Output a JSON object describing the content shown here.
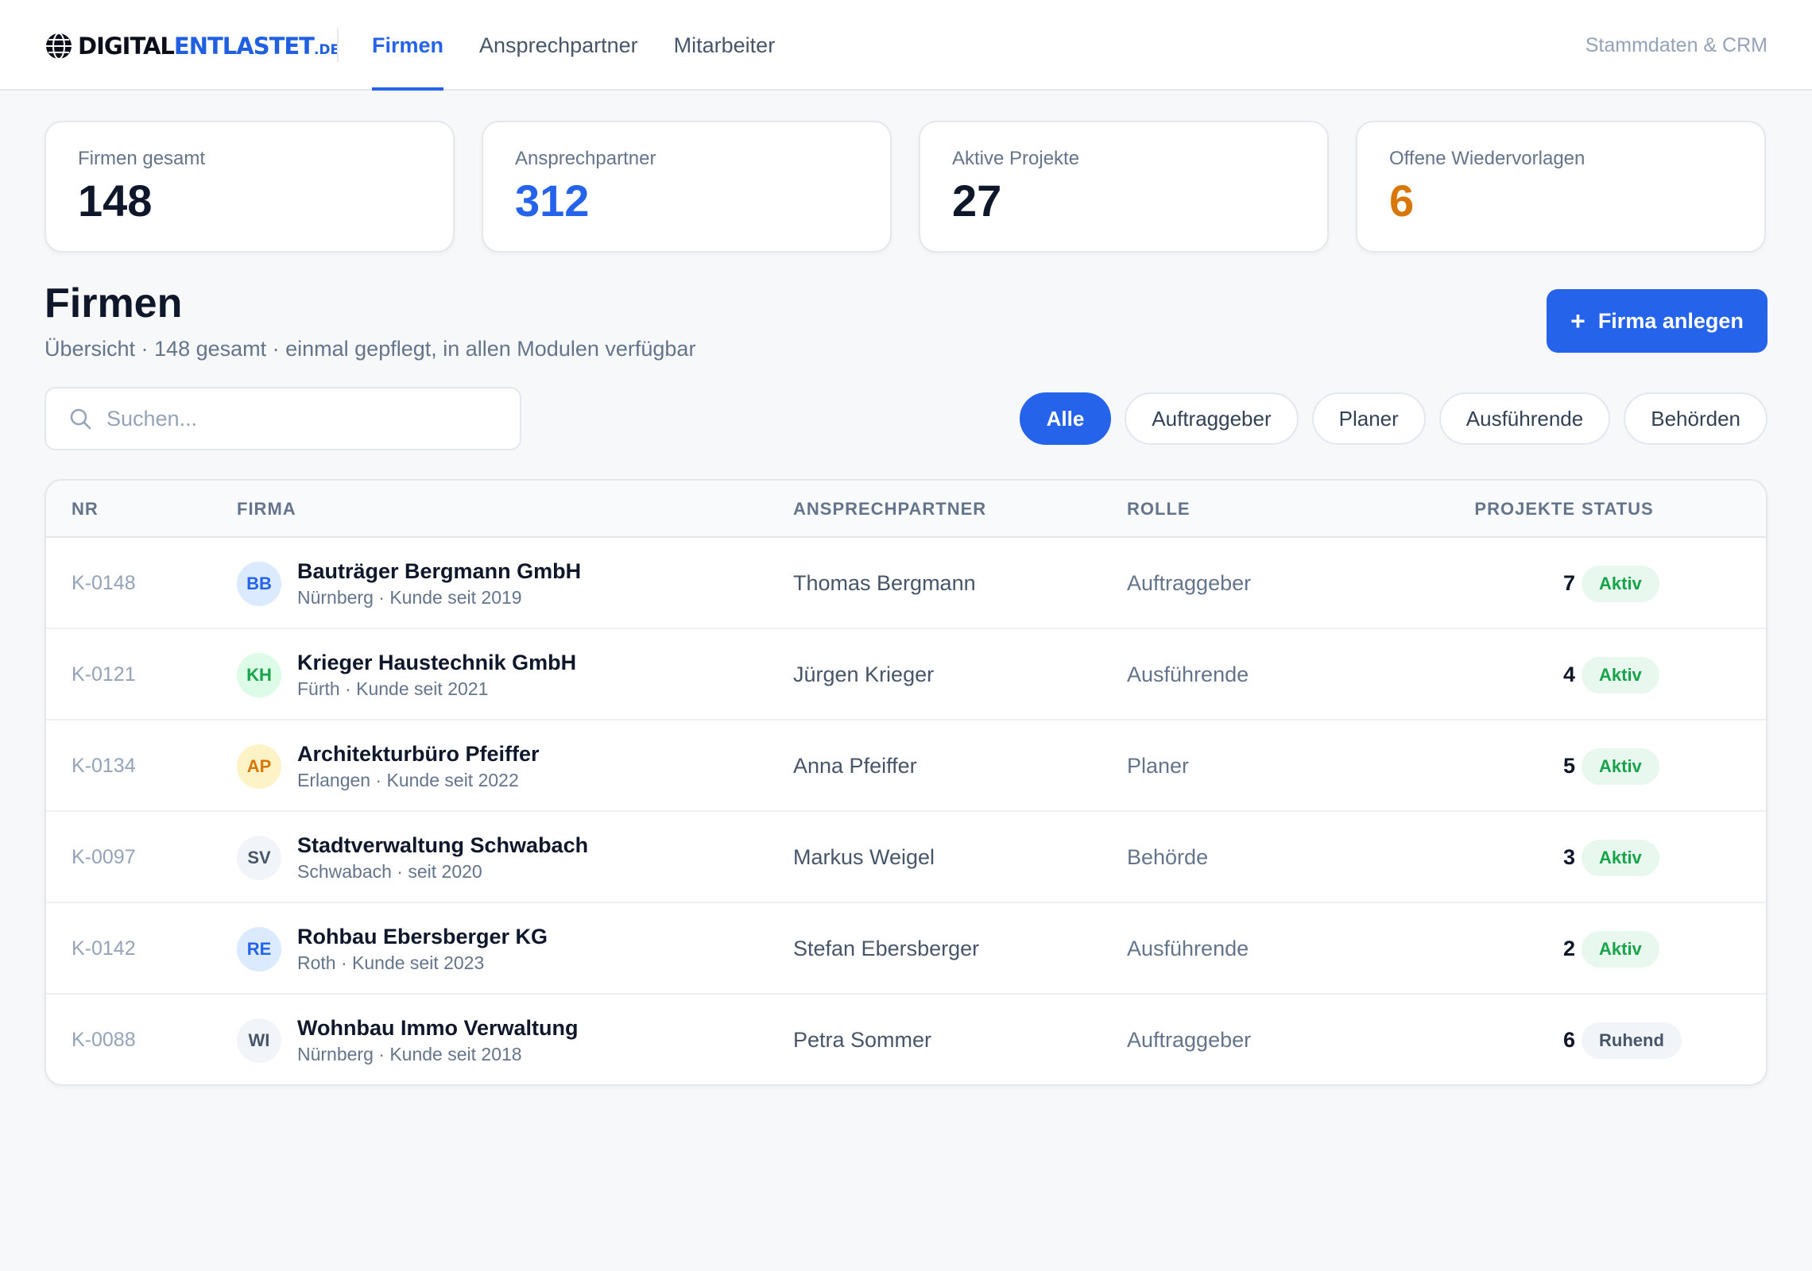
{
  "header": {
    "logo": {
      "part1": "DIGITAL",
      "part2": "ENTLASTET",
      "tld": ".DE"
    },
    "tabs": [
      {
        "label": "Firmen",
        "active": true
      },
      {
        "label": "Ansprechpartner",
        "active": false
      },
      {
        "label": "Mitarbeiter",
        "active": false
      }
    ],
    "right_label": "Stammdaten & CRM"
  },
  "stats": [
    {
      "label": "Firmen gesamt",
      "value": "148",
      "color": "#0f172a"
    },
    {
      "label": "Ansprechpartner",
      "value": "312",
      "color": "#2563eb"
    },
    {
      "label": "Aktive Projekte",
      "value": "27",
      "color": "#0f172a"
    },
    {
      "label": "Offene Wiedervorlagen",
      "value": "6",
      "color": "#d97706"
    }
  ],
  "page": {
    "title": "Firmen",
    "subtitle": "Übersicht · 148 gesamt · einmal gepflegt, in allen Modulen verfügbar",
    "add_button": {
      "icon": "plus-icon",
      "label": "Firma anlegen"
    }
  },
  "search": {
    "placeholder": "Suchen...",
    "value": ""
  },
  "filters": [
    {
      "label": "Alle",
      "active": true
    },
    {
      "label": "Auftraggeber",
      "active": false
    },
    {
      "label": "Planer",
      "active": false
    },
    {
      "label": "Ausführende",
      "active": false
    },
    {
      "label": "Behörden",
      "active": false
    }
  ],
  "table": {
    "columns": {
      "nr": "NR",
      "firma": "FIRMA",
      "contact": "ANSPRECHPARTNER",
      "role": "ROLLE",
      "projects": "PROJEKTE",
      "status": "STATUS"
    },
    "rows": [
      {
        "nr": "K-0148",
        "initials": "BB",
        "avatar_bg": "#dbeafe",
        "avatar_fg": "#2563eb",
        "name": "Bauträger Bergmann GmbH",
        "sub": "Nürnberg · Kunde seit 2019",
        "contact": "Thomas Bergmann",
        "role": "Auftraggeber",
        "projects": "7",
        "status": "Aktiv",
        "status_bg": "#e8f8ee",
        "status_fg": "#16a34a"
      },
      {
        "nr": "K-0121",
        "initials": "KH",
        "avatar_bg": "#dcfce7",
        "avatar_fg": "#16a34a",
        "name": "Krieger Haustechnik GmbH",
        "sub": "Fürth · Kunde seit 2021",
        "contact": "Jürgen Krieger",
        "role": "Ausführende",
        "projects": "4",
        "status": "Aktiv",
        "status_bg": "#e8f8ee",
        "status_fg": "#16a34a"
      },
      {
        "nr": "K-0134",
        "initials": "AP",
        "avatar_bg": "#fef3c7",
        "avatar_fg": "#d97706",
        "name": "Architekturbüro Pfeiffer",
        "sub": "Erlangen · Kunde seit 2022",
        "contact": "Anna Pfeiffer",
        "role": "Planer",
        "projects": "5",
        "status": "Aktiv",
        "status_bg": "#e8f8ee",
        "status_fg": "#16a34a"
      },
      {
        "nr": "K-0097",
        "initials": "SV",
        "avatar_bg": "#f1f5f9",
        "avatar_fg": "#475569",
        "name": "Stadtverwaltung Schwabach",
        "sub": "Schwabach · seit 2020",
        "contact": "Markus Weigel",
        "role": "Behörde",
        "projects": "3",
        "status": "Aktiv",
        "status_bg": "#e8f8ee",
        "status_fg": "#16a34a"
      },
      {
        "nr": "K-0142",
        "initials": "RE",
        "avatar_bg": "#dbeafe",
        "avatar_fg": "#2563eb",
        "name": "Rohbau Ebersberger KG",
        "sub": "Roth · Kunde seit 2023",
        "contact": "Stefan Ebersberger",
        "role": "Ausführende",
        "projects": "2",
        "status": "Aktiv",
        "status_bg": "#e8f8ee",
        "status_fg": "#16a34a"
      },
      {
        "nr": "K-0088",
        "initials": "WI",
        "avatar_bg": "#f1f5f9",
        "avatar_fg": "#475569",
        "name": "Wohnbau Immo Verwaltung",
        "sub": "Nürnberg · Kunde seit 2018",
        "contact": "Petra Sommer",
        "role": "Auftraggeber",
        "projects": "6",
        "status": "Ruhend",
        "status_bg": "#f1f5f9",
        "status_fg": "#475569"
      }
    ]
  }
}
